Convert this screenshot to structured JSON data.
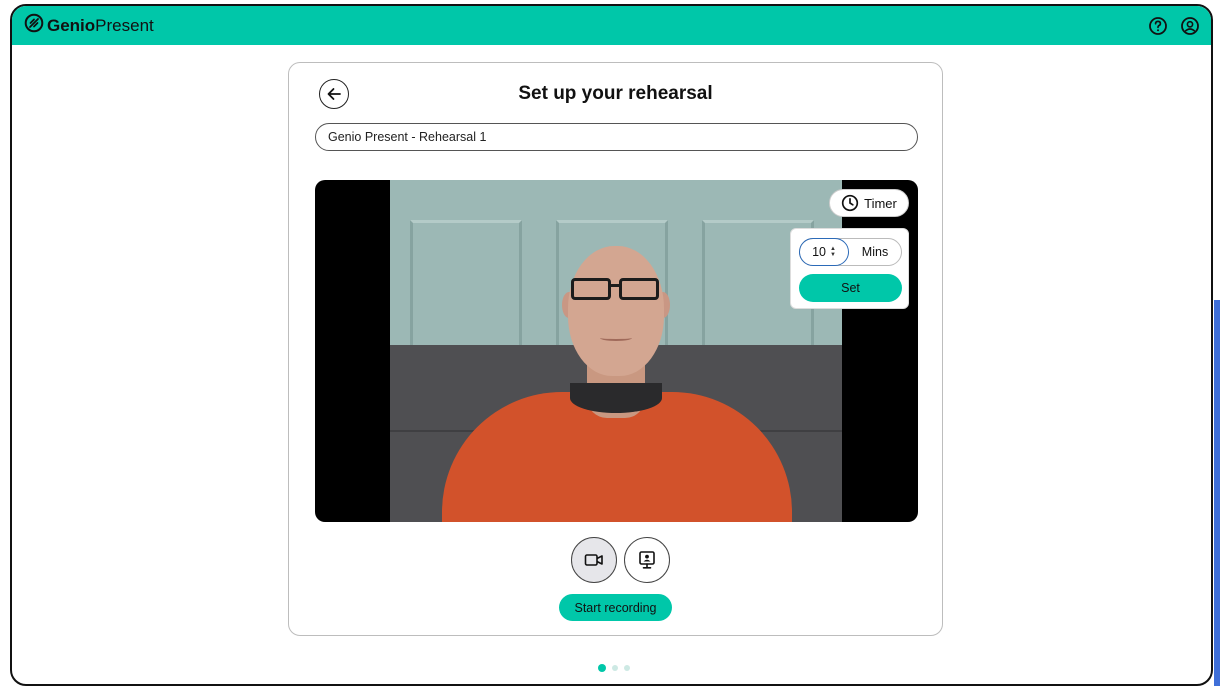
{
  "brand": {
    "name_bold": "Genio",
    "name_light": "Present"
  },
  "header": {
    "icons": [
      "help-icon",
      "account-icon"
    ]
  },
  "page": {
    "title": "Set up your rehearsal"
  },
  "rehearsal": {
    "name_value": "Genio Present - Rehearsal 1"
  },
  "timer": {
    "button_label": "Timer",
    "minutes_value": "10",
    "unit_label": "Mins",
    "set_label": "Set"
  },
  "controls": {
    "camera_icon": "video-camera-icon",
    "screen_icon": "screen-share-icon",
    "record_label": "Start recording"
  },
  "pagination": {
    "total": 3,
    "active": 1
  },
  "colors": {
    "accent": "#00c7a9",
    "focus": "#2b6ab8"
  }
}
